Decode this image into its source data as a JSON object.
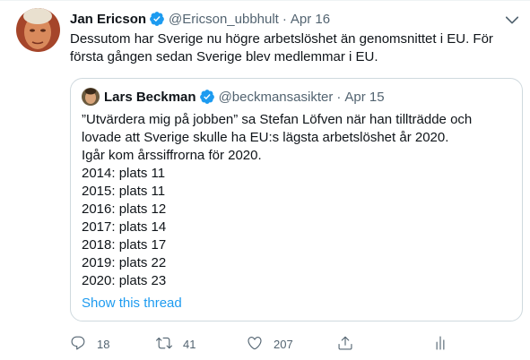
{
  "tweet": {
    "author_name": "Jan Ericson",
    "author_handle": "@Ericson_ubbhult",
    "separator": "·",
    "date": "Apr 16",
    "text": "Dessutom har Sverige nu högre arbetslöshet än genomsnittet i EU. För första gången sedan Sverige blev medlemmar i EU."
  },
  "quote": {
    "author_name": "Lars Beckman",
    "author_handle": "@beckmansasikter",
    "separator": "·",
    "date": "Apr 15",
    "lines": [
      "”Utvärdera mig på jobben” sa Stefan Löfven när han tillträdde och lovade att Sverige skulle ha EU:s lägsta arbetslöshet år 2020.",
      "Igår kom årssiffrorna för 2020.",
      "2014: plats 11",
      "2015: plats 11",
      "2016: plats 12",
      "2017: plats 14",
      "2018: plats 17",
      "2019: plats 22",
      "2020: plats 23"
    ],
    "show_thread": "Show this thread"
  },
  "actions": {
    "reply_count": "18",
    "retweet_count": "41",
    "like_count": "207",
    "reply_icon": "reply-icon",
    "retweet_icon": "retweet-icon",
    "like_icon": "heart-icon",
    "share_icon": "share-icon",
    "analytics_icon": "analytics-icon"
  },
  "colors": {
    "text": "#0f1419",
    "secondary": "#536471",
    "link": "#1d9bf0",
    "verified": "#1d9bf0",
    "border": "#cfd9de"
  }
}
